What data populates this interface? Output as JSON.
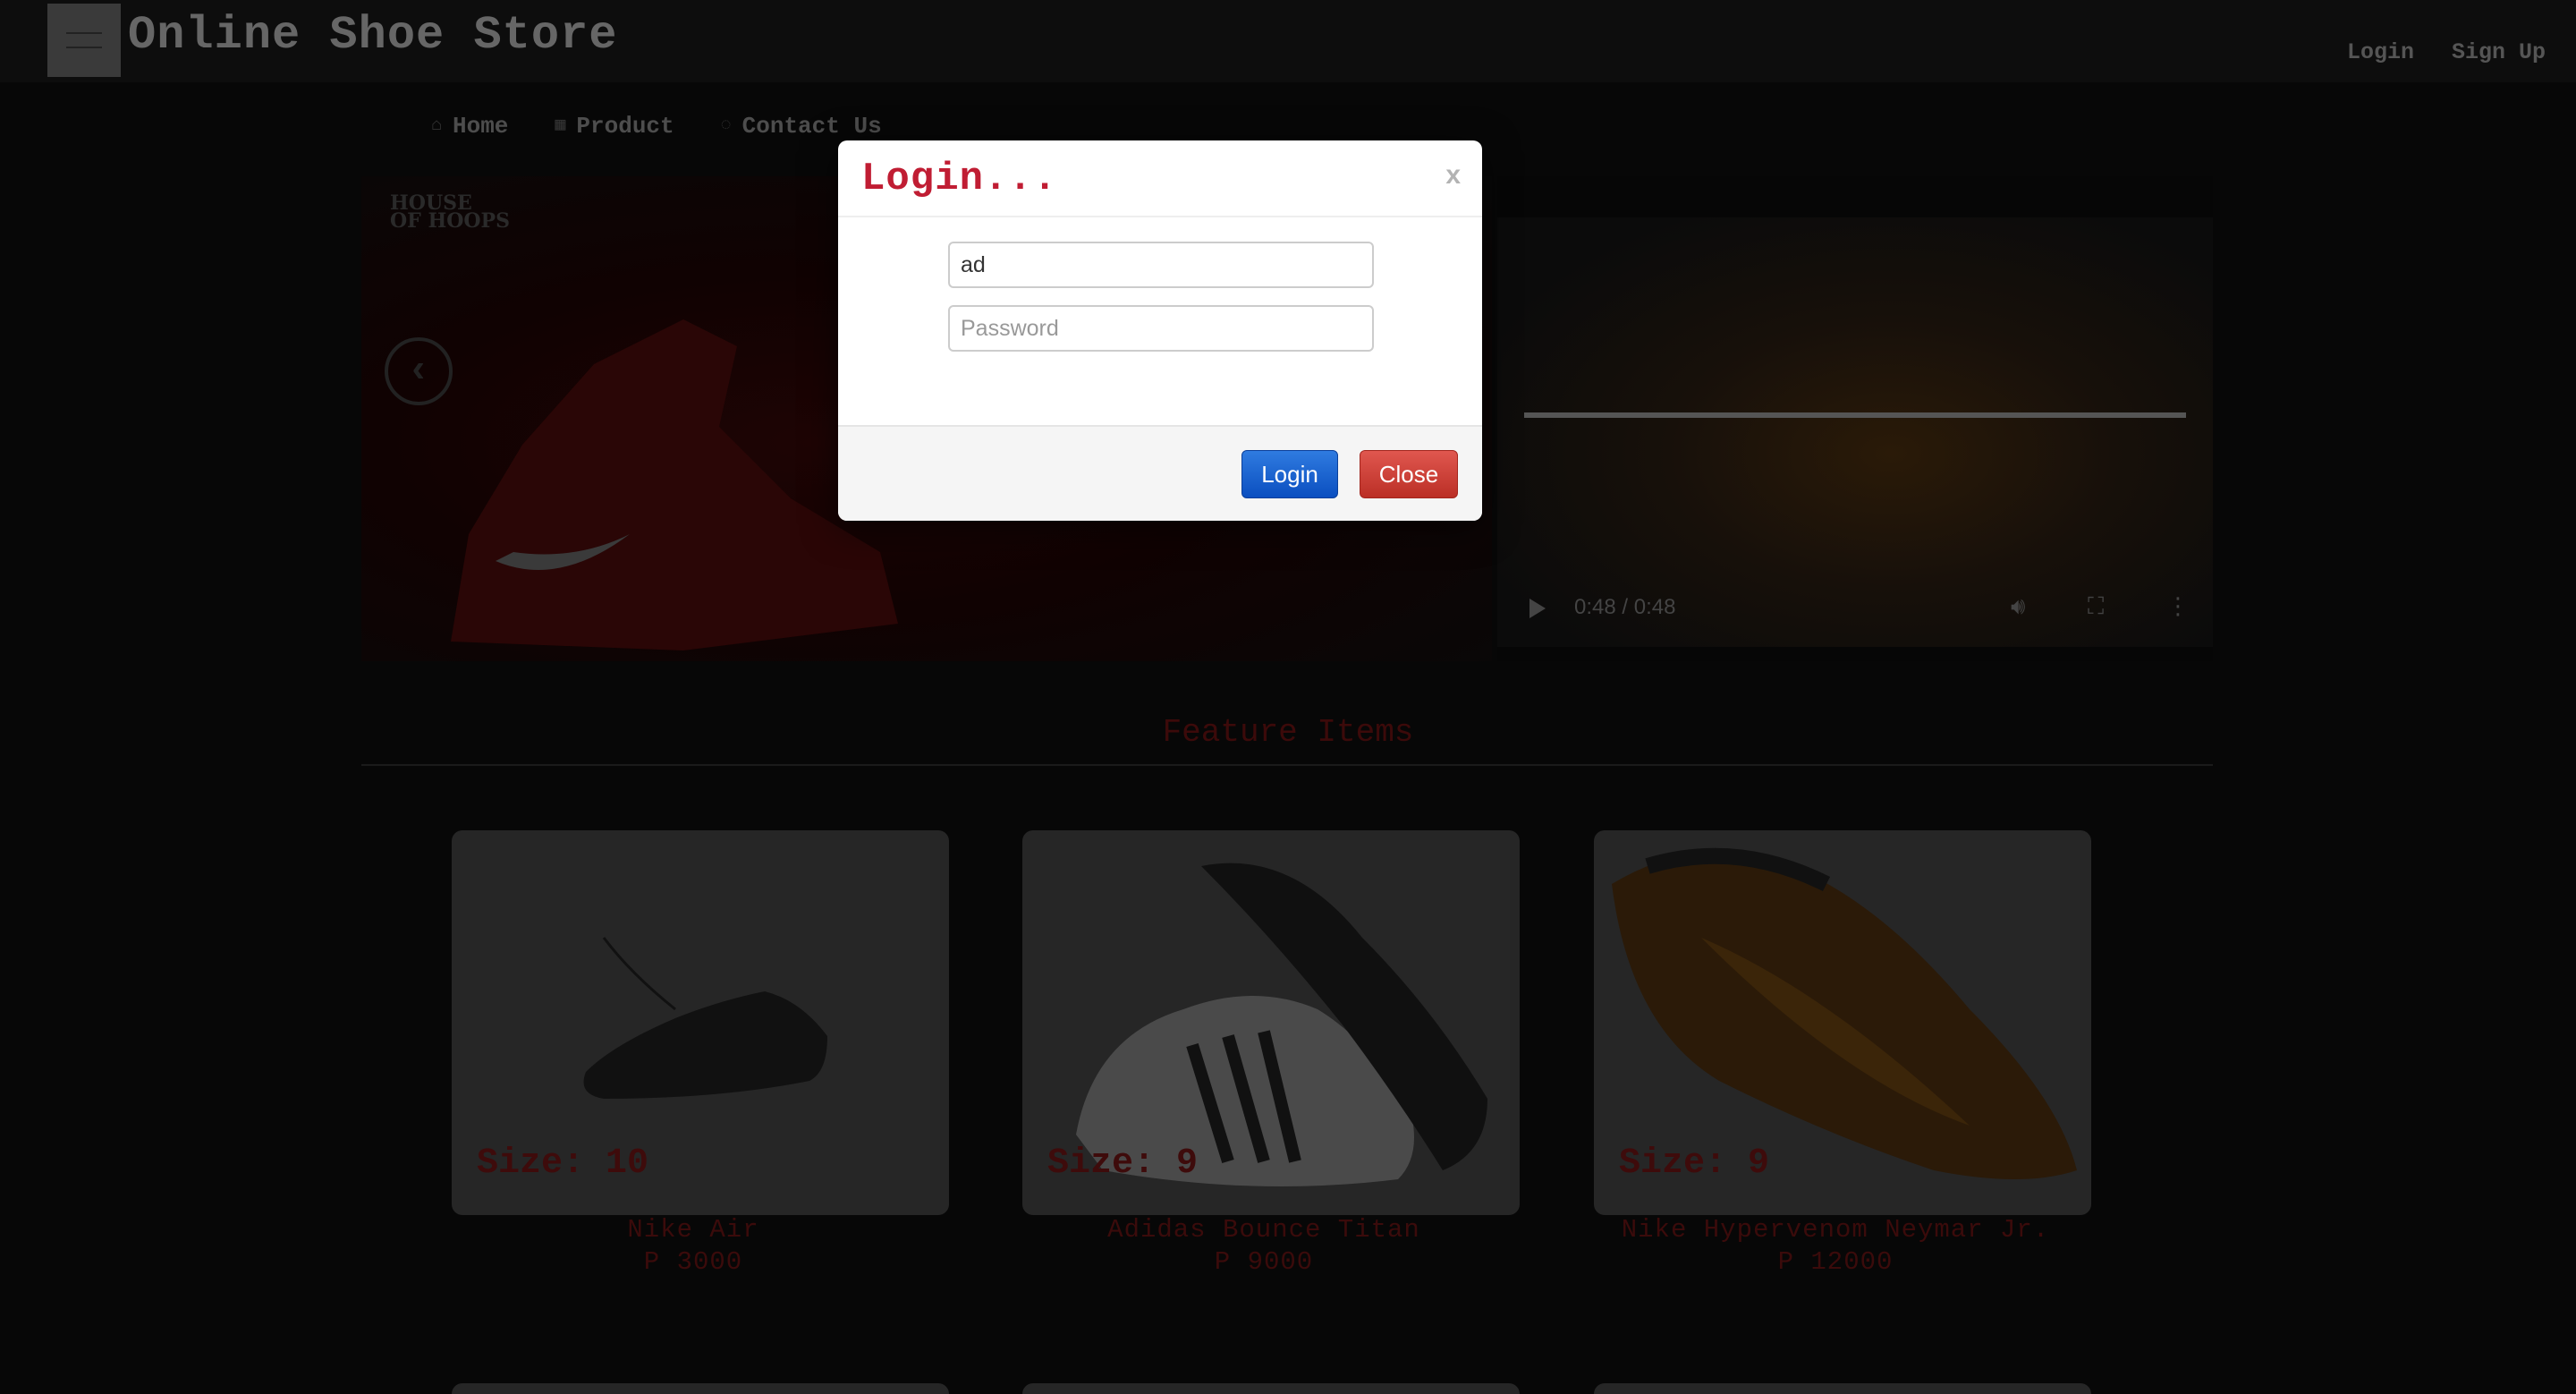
{
  "header": {
    "site_title": "Online Shoe Store",
    "login_link": "Login",
    "signup_link": "Sign Up"
  },
  "nav": {
    "items": [
      {
        "label": "Home",
        "icon": "home-icon"
      },
      {
        "label": "Product",
        "icon": "grid-icon"
      },
      {
        "label": "Contact Us",
        "icon": "info-icon"
      }
    ]
  },
  "hero": {
    "brand_text": "HOUSE\nOF HOOPS",
    "prev_arrow": "prev-arrow-icon"
  },
  "video": {
    "time": "0:48 / 0:48",
    "progress": 1.0
  },
  "features": {
    "title": "Feature Items",
    "products": [
      {
        "name": "Nike Air",
        "price": "P 3000",
        "size_label": "Size: 10"
      },
      {
        "name": "Adidas Bounce Titan",
        "price": "P 9000",
        "size_label": "Size: 9"
      },
      {
        "name": "Nike Hypervenom Neymar Jr.",
        "price": "P 12000",
        "size_label": "Size: 9"
      }
    ]
  },
  "modal": {
    "title": "Login...",
    "close_x": "x",
    "username_value": "ad",
    "password_placeholder": "Password",
    "login_button": "Login",
    "close_button": "Close"
  },
  "colors": {
    "modal_title": "#c01d33",
    "login_button": "#0b4fc0",
    "close_button": "#bb2f26",
    "overlay": "#000000"
  }
}
